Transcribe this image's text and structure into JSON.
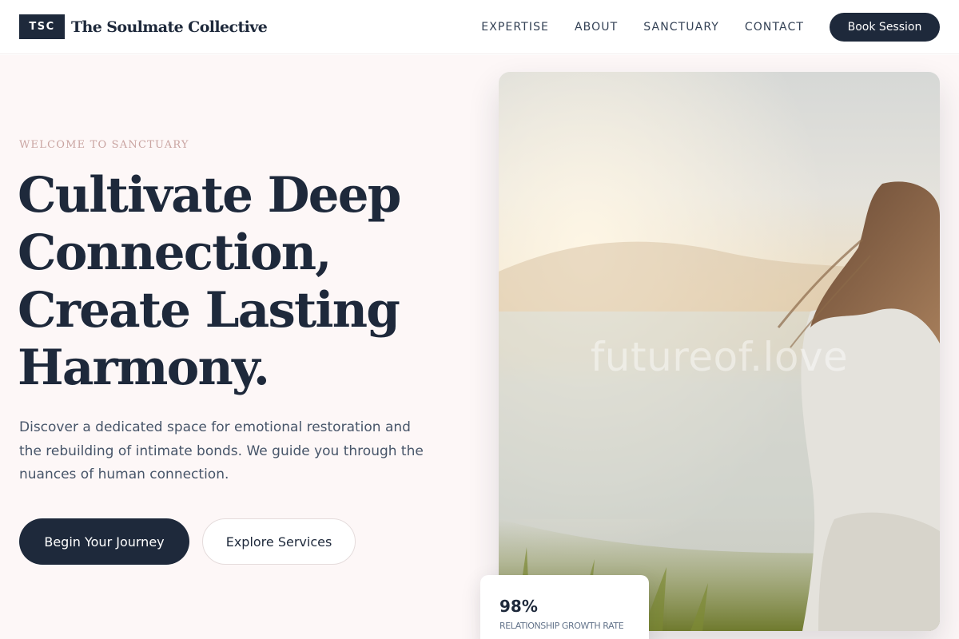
{
  "header": {
    "logo_badge": "TSC",
    "brand_name": "The Soulmate Collective",
    "nav": [
      "EXPERTISE",
      "ABOUT",
      "SANCTUARY",
      "CONTACT"
    ],
    "cta_label": "Book Session"
  },
  "hero": {
    "eyebrow": "WELCOME TO SANCTUARY",
    "headline_lines": [
      "Cultivate Deep",
      "Connection,",
      "Create Lasting",
      "Harmony."
    ],
    "lead": "Discover a dedicated space for emotional restoration and the rebuilding of intimate bonds. We guide you through the nuances of human connection.",
    "primary_cta": "Begin Your Journey",
    "secondary_cta": "Explore Services"
  },
  "image": {
    "watermark": "futureof.love"
  },
  "stat": {
    "value": "98%",
    "label": "RELATIONSHIP GROWTH RATE"
  },
  "colors": {
    "primary": "#1e293b",
    "hero_background": "#fdf7f7",
    "eyebrow": "#c9a4a1",
    "body_text": "#475569"
  }
}
